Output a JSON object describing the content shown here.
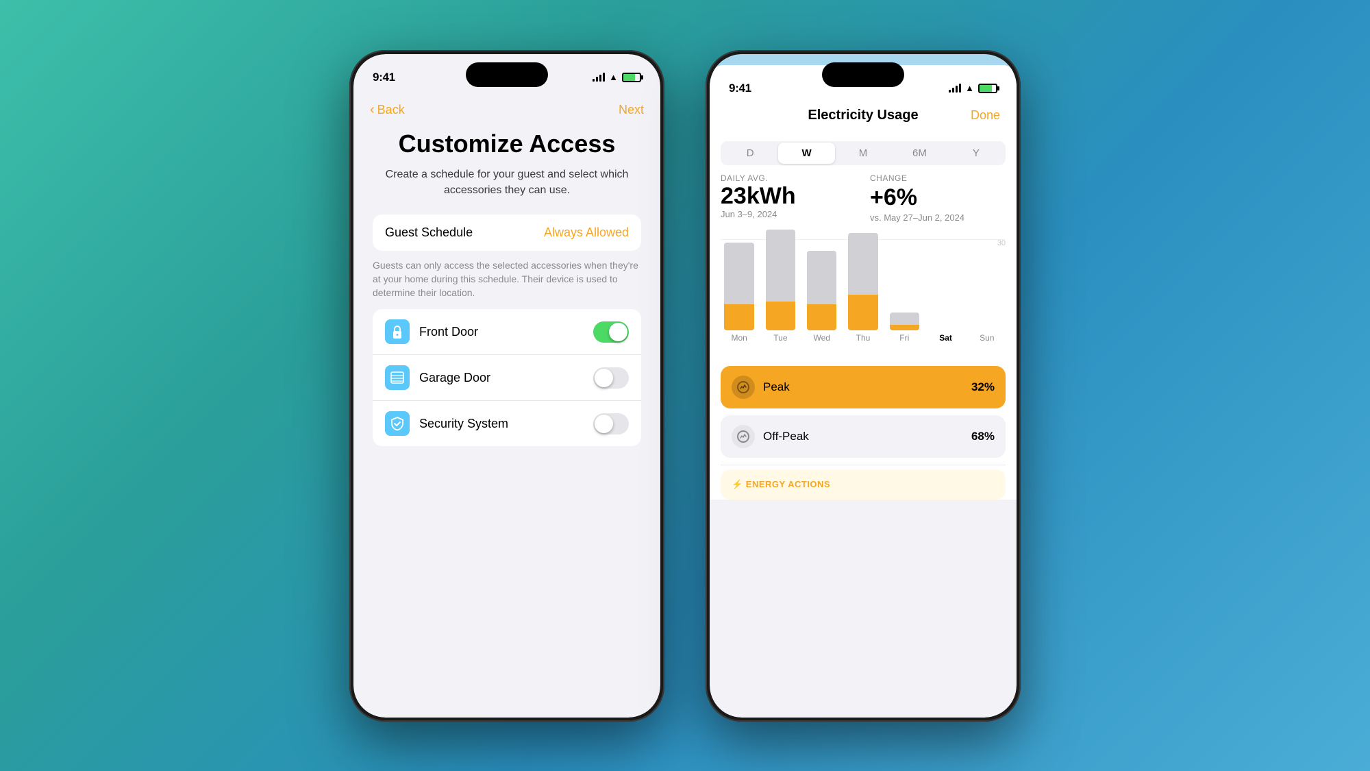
{
  "left_phone": {
    "status_time": "9:41",
    "nav": {
      "back_label": "Back",
      "next_label": "Next"
    },
    "title": "Customize Access",
    "subtitle": "Create a schedule for your guest and select which accessories they can use.",
    "guest_schedule": {
      "label": "Guest Schedule",
      "value": "Always Allowed",
      "description": "Guests can only access the selected accessories when they're at your home during this schedule. Their device is used to determine their location."
    },
    "accessories": [
      {
        "name": "Front Door",
        "icon": "🔒",
        "type": "lock",
        "enabled": true
      },
      {
        "name": "Garage Door",
        "icon": "🏠",
        "type": "garage",
        "enabled": false
      },
      {
        "name": "Security System",
        "icon": "✓",
        "type": "shield",
        "enabled": false
      }
    ]
  },
  "right_phone": {
    "status_time": "9:41",
    "title": "Electricity Usage",
    "done_label": "Done",
    "periods": [
      "D",
      "W",
      "M",
      "6M",
      "Y"
    ],
    "active_period": "W",
    "daily_avg_label": "DAILY AVG.",
    "daily_avg_value": "23kWh",
    "daily_avg_date": "Jun 3–9, 2024",
    "change_label": "CHANGE",
    "change_value": "+6%",
    "change_date": "vs. May 27–Jun 2, 2024",
    "chart_max_label": "30",
    "chart_bars": [
      {
        "day": "Mon",
        "upper_h": 90,
        "lower_h": 40,
        "active": false
      },
      {
        "day": "Tue",
        "upper_h": 110,
        "lower_h": 45,
        "active": false
      },
      {
        "day": "Wed",
        "upper_h": 80,
        "lower_h": 40,
        "active": false
      },
      {
        "day": "Thu",
        "upper_h": 95,
        "lower_h": 55,
        "active": false
      },
      {
        "day": "Fri",
        "upper_h": 20,
        "lower_h": 8,
        "active": false
      },
      {
        "day": "Sat",
        "upper_h": 0,
        "lower_h": 0,
        "active": true
      },
      {
        "day": "Sun",
        "upper_h": 0,
        "lower_h": 0,
        "active": false
      }
    ],
    "legend": [
      {
        "key": "peak",
        "label": "Peak",
        "pct": "32%",
        "style": "peak"
      },
      {
        "key": "offpeak",
        "label": "Off-Peak",
        "pct": "68%",
        "style": "offpeak"
      }
    ],
    "energy_actions_label": "⚡ ENERGY ACTIONS"
  }
}
